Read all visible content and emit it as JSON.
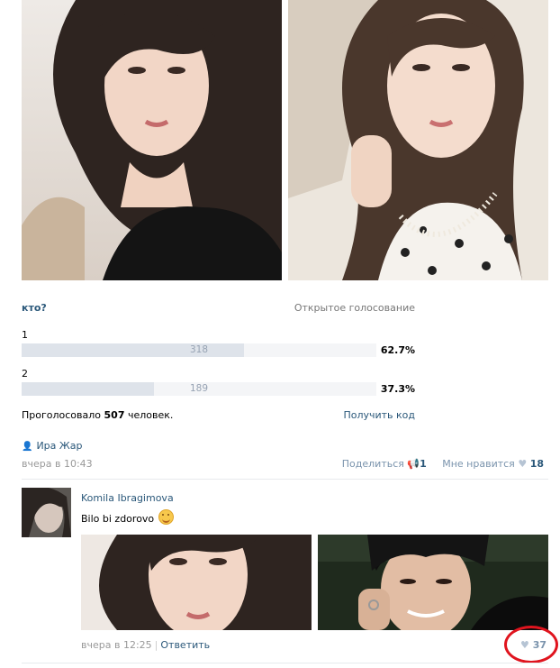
{
  "poll": {
    "question": "кто?",
    "type": "Открытое голосование",
    "options": [
      {
        "label": "1",
        "count": "318",
        "percent": "62.7%",
        "fraction": 0.627
      },
      {
        "label": "2",
        "count": "189",
        "percent": "37.3%",
        "fraction": 0.373
      }
    ],
    "voted_prefix": "Проголосовало",
    "voted_count": "507",
    "voted_suffix": "человек.",
    "get_code": "Получить код"
  },
  "post": {
    "author": "Ира Жар",
    "date": "вчера в 10:43",
    "share_label": "Поделиться",
    "share_count": "1",
    "like_label": "Мне нравится",
    "like_count": "18"
  },
  "comment": {
    "author": "Komila Ibragimova",
    "text": "Bilo bi zdorovo",
    "date": "вчера в 12:25",
    "reply": "Ответить",
    "likes": "37"
  },
  "icons": {
    "person": "person-icon",
    "share": "megaphone-icon",
    "heart": "heart-icon",
    "smile": "smile-emoji"
  },
  "colors": {
    "link": "#2b587a",
    "bar": "#dee3ea",
    "highlight": "#e0141e"
  }
}
